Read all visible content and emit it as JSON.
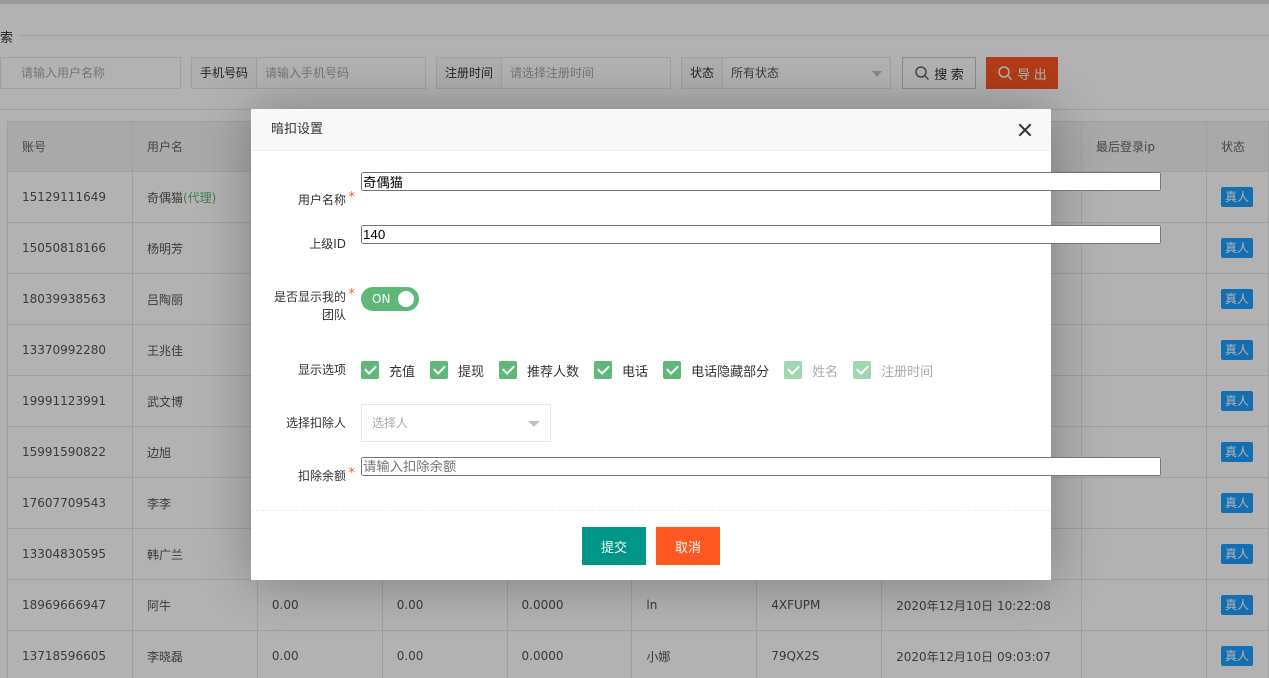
{
  "search": {
    "section_title": "索",
    "username_placeholder": "请输入用户名称",
    "phone_label": "手机号码",
    "phone_placeholder": "请输入手机号码",
    "regtime_label": "注册时间",
    "regtime_placeholder": "请选择注册时间",
    "status_label": "状态",
    "status_value": "所有状态",
    "search_button": "搜 索",
    "export_button": "导 出"
  },
  "table": {
    "headers": [
      "账号",
      "用户名",
      "",
      "",
      "",
      "",
      "",
      "",
      "最后登录ip",
      "状态"
    ],
    "rows": [
      {
        "account": "15129111649",
        "name": "奇偶猫",
        "tag": "(代理)",
        "c3": "",
        "c4": "",
        "c5": "",
        "c6": "",
        "c7": "",
        "c8": "",
        "c9": "",
        "status": "真人"
      },
      {
        "account": "15050818166",
        "name": "杨明芳",
        "tag": "",
        "c3": "",
        "c4": "",
        "c5": "",
        "c6": "",
        "c7": "",
        "c8": "",
        "c9": "",
        "status": "真人"
      },
      {
        "account": "18039938563",
        "name": "吕陶丽",
        "tag": "",
        "c3": "",
        "c4": "",
        "c5": "",
        "c6": "",
        "c7": "",
        "c8": "",
        "c9": "",
        "status": "真人"
      },
      {
        "account": "13370992280",
        "name": "王兆佳",
        "tag": "",
        "c3": "",
        "c4": "",
        "c5": "",
        "c6": "",
        "c7": "",
        "c8": "",
        "c9": "",
        "status": "真人"
      },
      {
        "account": "19991123991",
        "name": "武文博",
        "tag": "",
        "c3": "",
        "c4": "",
        "c5": "",
        "c6": "",
        "c7": "",
        "c8": "",
        "c9": "",
        "status": "真人"
      },
      {
        "account": "15991590822",
        "name": "边旭",
        "tag": "",
        "c3": "",
        "c4": "",
        "c5": "",
        "c6": "",
        "c7": "",
        "c8": "",
        "c9": "",
        "status": "真人"
      },
      {
        "account": "17607709543",
        "name": "李李",
        "tag": "",
        "c3": "",
        "c4": "",
        "c5": "",
        "c6": "",
        "c7": "",
        "c8": "",
        "c9": "",
        "status": "真人"
      },
      {
        "account": "13304830595",
        "name": "韩广兰",
        "tag": "",
        "c3": "",
        "c4": "",
        "c5": "",
        "c6": "",
        "c7": "",
        "c8": "",
        "c9": "",
        "status": "真人"
      },
      {
        "account": "18969666947",
        "name": "阿牛",
        "tag": "",
        "c3": "0.00",
        "c4": "0.00",
        "c5": "0.0000",
        "c6": "ln",
        "c7": "4XFUPM",
        "c8": "2020年12月10日 10:22:08",
        "c9": "",
        "status": "真人"
      },
      {
        "account": "13718596605",
        "name": "李晓磊",
        "tag": "",
        "c3": "0.00",
        "c4": "0.00",
        "c5": "0.0000",
        "c6": "小娜",
        "c7": "79QX2S",
        "c8": "2020年12月10日 09:03:07",
        "c9": "",
        "status": "真人"
      }
    ]
  },
  "modal": {
    "title": "暗扣设置",
    "username_label": "用户名称",
    "username_value": "奇偶猫",
    "parent_label": "上级ID",
    "parent_value": "140",
    "show_team_label": "是否显示我的团队",
    "show_team_state": "ON",
    "options_label": "显示选项",
    "options": [
      {
        "label": "充值",
        "checked": true
      },
      {
        "label": "提现",
        "checked": true
      },
      {
        "label": "推荐人数",
        "checked": true
      },
      {
        "label": "电话",
        "checked": true
      },
      {
        "label": "电话隐藏部分",
        "checked": true
      },
      {
        "label": "姓名",
        "checked": true
      },
      {
        "label": "注册时间",
        "checked": true
      }
    ],
    "deductor_label": "选择扣除人",
    "deductor_placeholder": "选择人",
    "amount_label": "扣除余额",
    "amount_placeholder": "请输入扣除余额",
    "submit_label": "提交",
    "cancel_label": "取消"
  },
  "colors": {
    "accent_green": "#5fb878",
    "submit_teal": "#009688",
    "danger_orange": "#ff5722",
    "badge_blue": "#1e9fff"
  }
}
